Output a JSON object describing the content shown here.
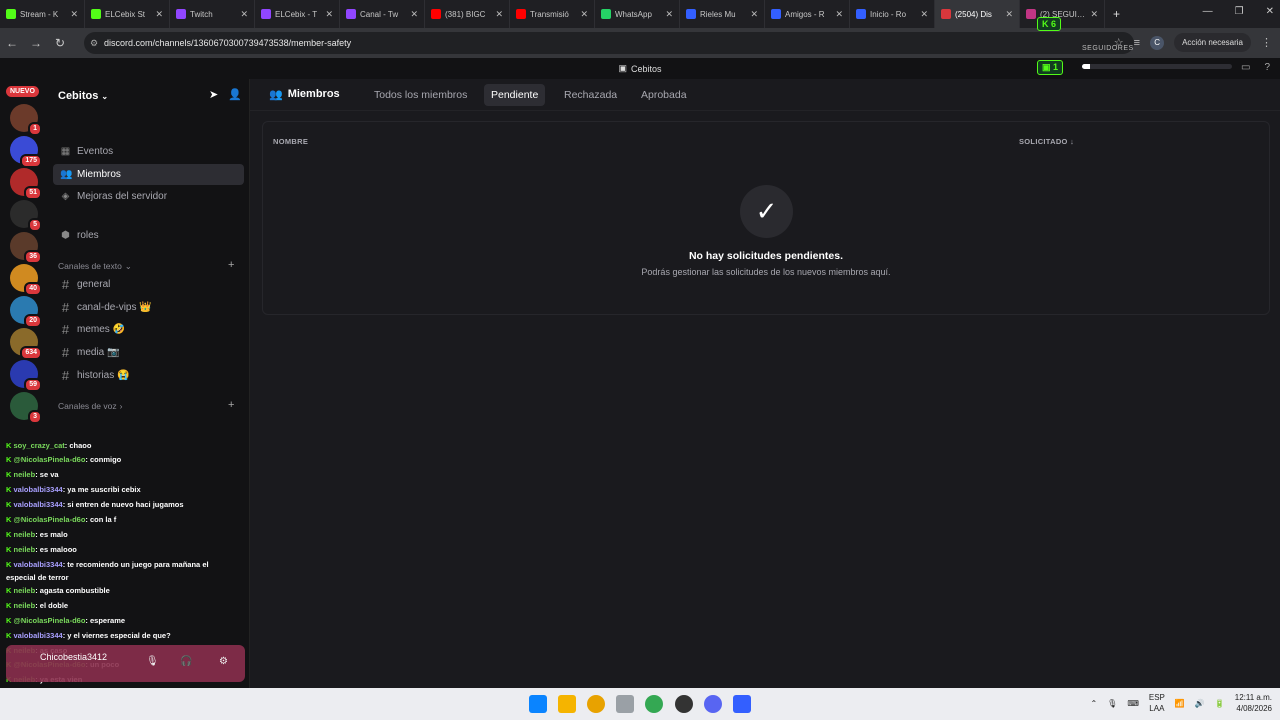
{
  "browser": {
    "tabs": [
      {
        "label": "Stream - K",
        "color": "#53fc18"
      },
      {
        "label": "ELCebix St",
        "color": "#53fc18"
      },
      {
        "label": "Twitch",
        "color": "#9146ff"
      },
      {
        "label": "ELCebix - T",
        "color": "#9146ff"
      },
      {
        "label": "Canal - Tw",
        "color": "#9146ff"
      },
      {
        "label": "(381) BIGC",
        "color": "#ff0000"
      },
      {
        "label": "Transmisió",
        "color": "#ff0000"
      },
      {
        "label": "WhatsApp",
        "color": "#25d366"
      },
      {
        "label": "Rieles Mu",
        "color": "#335fff"
      },
      {
        "label": "Amigos - R",
        "color": "#335fff"
      },
      {
        "label": "Inicio - Ro",
        "color": "#335fff"
      },
      {
        "label": "(2504) Dis",
        "color": "#da373c",
        "active": true
      },
      {
        "label": "(2) SEGUIDORES",
        "color": "#c13584"
      }
    ],
    "url": "discord.com/channels/1360670300739473538/member-safety",
    "action_label": "Acción necesaria",
    "profile_initial": "C"
  },
  "overlay": {
    "kick_count": "6",
    "seguidores": "SEGUIDORES",
    "ig_count": "1",
    "progress_fraction": 0.05
  },
  "discord": {
    "window_title": "Cebitos",
    "server_name": "Cebitos",
    "nuevo_badge": "NUEVO",
    "server_badges": [
      "1",
      "175",
      "51",
      "5",
      "36",
      "40",
      "20",
      "634",
      "59",
      "3"
    ],
    "channels_top": [
      {
        "label": "Eventos",
        "icon": "calendar-icon"
      },
      {
        "label": "Miembros",
        "icon": "members-icon",
        "active": true
      },
      {
        "label": "Mejoras del servidor",
        "icon": "boost-icon"
      },
      {
        "label": "roles",
        "icon": "roles-icon"
      }
    ],
    "text_category": "Canales de texto",
    "text_channels": [
      "general",
      "canal-de-vips 👑",
      "memes 🤣",
      "media 📷",
      "historias 😭"
    ],
    "voice_category": "Canales de voz",
    "main": {
      "title": "Miembros",
      "tabs": [
        "Todos los miembros",
        "Pendiente",
        "Rechazada",
        "Aprobada"
      ],
      "active_tab": "Pendiente",
      "col_name": "NOMBRE",
      "col_requested": "SOLICITADO",
      "empty_title": "No hay solicitudes pendientes.",
      "empty_sub": "Podrás gestionar las solicitudes de los nuevos miembros aquí."
    },
    "username": "Chicobestia3412"
  },
  "chat": [
    {
      "user": "soy_crazy_cat",
      "text": ": chaoo",
      "blue": false
    },
    {
      "user": "@NicolasPinela-d6o",
      "text": ": conmigo",
      "blue": false
    },
    {
      "user": "neileb",
      "text": ": se va",
      "blue": false
    },
    {
      "user": "valobalbi3344",
      "text": ": ya me suscribi cebix",
      "blue": true
    },
    {
      "user": "valobalbi3344",
      "text": ": si entren de nuevo haci jugamos",
      "blue": true
    },
    {
      "user": "@NicolasPinela-d6o",
      "text": ": con la f",
      "blue": false
    },
    {
      "user": "neileb",
      "text": ": es malo",
      "blue": false
    },
    {
      "user": "neileb",
      "text": ": es malooo",
      "blue": false
    },
    {
      "user": "valobalbi3344",
      "text": ": te recomiendo un juego para mañana el",
      "blue": true
    },
    {
      "user": "",
      "text": "especial de terror",
      "blue": false
    },
    {
      "user": "neileb",
      "text": ": agasta combustible",
      "blue": false
    },
    {
      "user": "neileb",
      "text": ": el doble",
      "blue": false
    },
    {
      "user": "@NicolasPinela-d6o",
      "text": ": esperame",
      "blue": false
    },
    {
      "user": "valobalbi3344",
      "text": ": y el viernes especial de que?",
      "blue": true
    },
    {
      "user": "neileb",
      "text": ": as caso",
      "blue": false
    },
    {
      "user": "@NicolasPinela-d6o",
      "text": ": un poco",
      "blue": false
    },
    {
      "user": "neileb",
      "text": ": ya esta vien",
      "blue": false
    }
  ],
  "taskbar": {
    "lang_line1": "ESP",
    "lang_line2": "LAA",
    "time": "12:11 a.m.",
    "date": "4/08/2026"
  }
}
